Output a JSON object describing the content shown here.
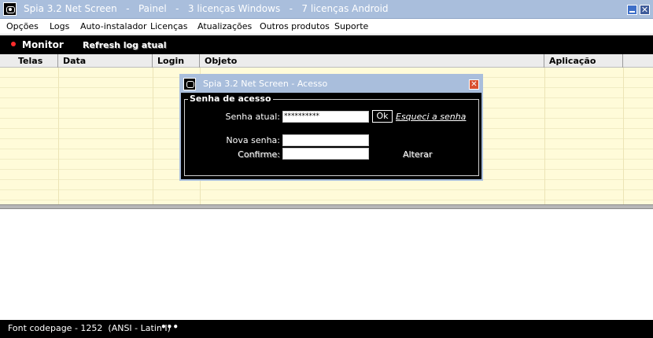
{
  "window": {
    "title": "Spia 3.2 Net Screen   -   Painel   -   3 licenças Windows   -   7 licenças Android",
    "close_glyph": "✕"
  },
  "menu": {
    "items": [
      "Opções",
      "Logs",
      "Auto-instalador",
      "Licenças",
      "Atualizações",
      "Outros produtos",
      "Suporte"
    ]
  },
  "toolbar": {
    "monitor_label": "Monitor",
    "refresh_label": "Refresh log atual"
  },
  "table": {
    "columns": [
      "Telas",
      "Data",
      "Login",
      "Objeto",
      "Aplicação"
    ]
  },
  "dialog": {
    "title": "Spia 3.2 Net Screen - Acesso",
    "close_glyph": "✕",
    "group_title": "Senha de acesso",
    "current_password_label": "Senha atual:",
    "current_password_value": "**********",
    "ok_label": "Ok",
    "forgot_link": "Esqueci a senha",
    "new_password_label": "Nova senha:",
    "new_password_value": "",
    "confirm_label": "Confirme:",
    "confirm_value": "",
    "change_label": "Alterar"
  },
  "status": {
    "codepage": "Font codepage - 1252  (ANSI - Latin I)",
    "ellipsis": "•••"
  },
  "colors": {
    "titlebar": "#a9bedc",
    "log_background": "#fffbd9",
    "toolbar": "#000000",
    "monitor_dot": "#ff2d2d"
  },
  "icons": {
    "app": "spia-eye-icon",
    "minimize": "minimize-icon",
    "close": "close-icon"
  }
}
